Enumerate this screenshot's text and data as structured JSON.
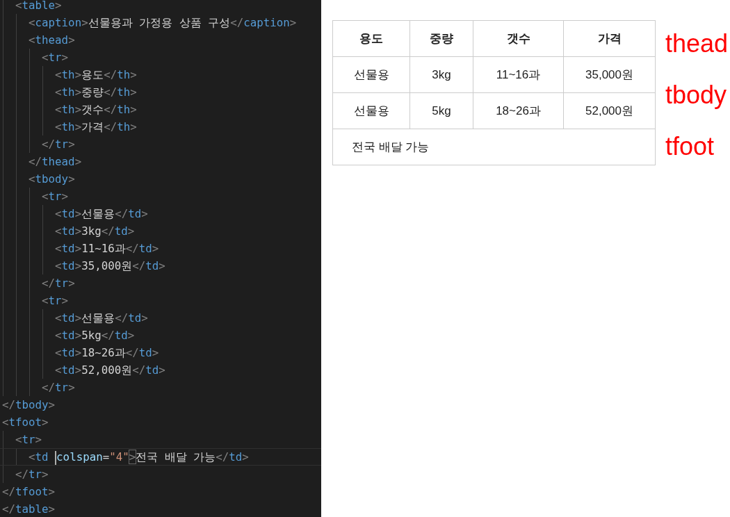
{
  "editor": {
    "lines": [
      {
        "current": false,
        "tokens": [
          {
            "kind": "punct",
            "text": "  <"
          },
          {
            "kind": "tag",
            "text": "table"
          },
          {
            "kind": "punct",
            "text": ">"
          }
        ]
      },
      {
        "current": false,
        "tokens": [
          {
            "kind": "punct",
            "text": "    <"
          },
          {
            "kind": "tag",
            "text": "caption"
          },
          {
            "kind": "punct",
            "text": ">"
          },
          {
            "kind": "text",
            "text": "선물용과 가정용 상품 구성"
          },
          {
            "kind": "punct",
            "text": "</"
          },
          {
            "kind": "tag",
            "text": "caption"
          },
          {
            "kind": "punct",
            "text": ">"
          }
        ]
      },
      {
        "current": false,
        "tokens": [
          {
            "kind": "punct",
            "text": "    <"
          },
          {
            "kind": "tag",
            "text": "thead"
          },
          {
            "kind": "punct",
            "text": ">"
          }
        ]
      },
      {
        "current": false,
        "tokens": [
          {
            "kind": "punct",
            "text": "      <"
          },
          {
            "kind": "tag",
            "text": "tr"
          },
          {
            "kind": "punct",
            "text": ">"
          }
        ]
      },
      {
        "current": false,
        "tokens": [
          {
            "kind": "punct",
            "text": "        <"
          },
          {
            "kind": "tag",
            "text": "th"
          },
          {
            "kind": "punct",
            "text": ">"
          },
          {
            "kind": "text",
            "text": "용도"
          },
          {
            "kind": "punct",
            "text": "</"
          },
          {
            "kind": "tag",
            "text": "th"
          },
          {
            "kind": "punct",
            "text": ">"
          }
        ]
      },
      {
        "current": false,
        "tokens": [
          {
            "kind": "punct",
            "text": "        <"
          },
          {
            "kind": "tag",
            "text": "th"
          },
          {
            "kind": "punct",
            "text": ">"
          },
          {
            "kind": "text",
            "text": "중량"
          },
          {
            "kind": "punct",
            "text": "</"
          },
          {
            "kind": "tag",
            "text": "th"
          },
          {
            "kind": "punct",
            "text": ">"
          }
        ]
      },
      {
        "current": false,
        "tokens": [
          {
            "kind": "punct",
            "text": "        <"
          },
          {
            "kind": "tag",
            "text": "th"
          },
          {
            "kind": "punct",
            "text": ">"
          },
          {
            "kind": "text",
            "text": "갯수"
          },
          {
            "kind": "punct",
            "text": "</"
          },
          {
            "kind": "tag",
            "text": "th"
          },
          {
            "kind": "punct",
            "text": ">"
          }
        ]
      },
      {
        "current": false,
        "tokens": [
          {
            "kind": "punct",
            "text": "        <"
          },
          {
            "kind": "tag",
            "text": "th"
          },
          {
            "kind": "punct",
            "text": ">"
          },
          {
            "kind": "text",
            "text": "가격"
          },
          {
            "kind": "punct",
            "text": "</"
          },
          {
            "kind": "tag",
            "text": "th"
          },
          {
            "kind": "punct",
            "text": ">"
          }
        ]
      },
      {
        "current": false,
        "tokens": [
          {
            "kind": "punct",
            "text": "      </"
          },
          {
            "kind": "tag",
            "text": "tr"
          },
          {
            "kind": "punct",
            "text": ">"
          }
        ]
      },
      {
        "current": false,
        "tokens": [
          {
            "kind": "punct",
            "text": "    </"
          },
          {
            "kind": "tag",
            "text": "thead"
          },
          {
            "kind": "punct",
            "text": ">"
          }
        ]
      },
      {
        "current": false,
        "tokens": [
          {
            "kind": "punct",
            "text": "    <"
          },
          {
            "kind": "tag",
            "text": "tbody"
          },
          {
            "kind": "punct",
            "text": ">"
          }
        ]
      },
      {
        "current": false,
        "tokens": [
          {
            "kind": "punct",
            "text": "      <"
          },
          {
            "kind": "tag",
            "text": "tr"
          },
          {
            "kind": "punct",
            "text": ">"
          }
        ]
      },
      {
        "current": false,
        "tokens": [
          {
            "kind": "punct",
            "text": "        <"
          },
          {
            "kind": "tag",
            "text": "td"
          },
          {
            "kind": "punct",
            "text": ">"
          },
          {
            "kind": "text",
            "text": "선물용"
          },
          {
            "kind": "punct",
            "text": "</"
          },
          {
            "kind": "tag",
            "text": "td"
          },
          {
            "kind": "punct",
            "text": ">"
          }
        ]
      },
      {
        "current": false,
        "tokens": [
          {
            "kind": "punct",
            "text": "        <"
          },
          {
            "kind": "tag",
            "text": "td"
          },
          {
            "kind": "punct",
            "text": ">"
          },
          {
            "kind": "text",
            "text": "3kg"
          },
          {
            "kind": "punct",
            "text": "</"
          },
          {
            "kind": "tag",
            "text": "td"
          },
          {
            "kind": "punct",
            "text": ">"
          }
        ]
      },
      {
        "current": false,
        "tokens": [
          {
            "kind": "punct",
            "text": "        <"
          },
          {
            "kind": "tag",
            "text": "td"
          },
          {
            "kind": "punct",
            "text": ">"
          },
          {
            "kind": "text",
            "text": "11~16과"
          },
          {
            "kind": "punct",
            "text": "</"
          },
          {
            "kind": "tag",
            "text": "td"
          },
          {
            "kind": "punct",
            "text": ">"
          }
        ]
      },
      {
        "current": false,
        "tokens": [
          {
            "kind": "punct",
            "text": "        <"
          },
          {
            "kind": "tag",
            "text": "td"
          },
          {
            "kind": "punct",
            "text": ">"
          },
          {
            "kind": "text",
            "text": "35,000원"
          },
          {
            "kind": "punct",
            "text": "</"
          },
          {
            "kind": "tag",
            "text": "td"
          },
          {
            "kind": "punct",
            "text": ">"
          }
        ]
      },
      {
        "current": false,
        "tokens": [
          {
            "kind": "punct",
            "text": "      </"
          },
          {
            "kind": "tag",
            "text": "tr"
          },
          {
            "kind": "punct",
            "text": ">"
          }
        ]
      },
      {
        "current": false,
        "tokens": [
          {
            "kind": "punct",
            "text": "      <"
          },
          {
            "kind": "tag",
            "text": "tr"
          },
          {
            "kind": "punct",
            "text": ">"
          }
        ]
      },
      {
        "current": false,
        "tokens": [
          {
            "kind": "punct",
            "text": "        <"
          },
          {
            "kind": "tag",
            "text": "td"
          },
          {
            "kind": "punct",
            "text": ">"
          },
          {
            "kind": "text",
            "text": "선물용"
          },
          {
            "kind": "punct",
            "text": "</"
          },
          {
            "kind": "tag",
            "text": "td"
          },
          {
            "kind": "punct",
            "text": ">"
          }
        ]
      },
      {
        "current": false,
        "tokens": [
          {
            "kind": "punct",
            "text": "        <"
          },
          {
            "kind": "tag",
            "text": "td"
          },
          {
            "kind": "punct",
            "text": ">"
          },
          {
            "kind": "text",
            "text": "5kg"
          },
          {
            "kind": "punct",
            "text": "</"
          },
          {
            "kind": "tag",
            "text": "td"
          },
          {
            "kind": "punct",
            "text": ">"
          }
        ]
      },
      {
        "current": false,
        "tokens": [
          {
            "kind": "punct",
            "text": "        <"
          },
          {
            "kind": "tag",
            "text": "td"
          },
          {
            "kind": "punct",
            "text": ">"
          },
          {
            "kind": "text",
            "text": "18~26과"
          },
          {
            "kind": "punct",
            "text": "</"
          },
          {
            "kind": "tag",
            "text": "td"
          },
          {
            "kind": "punct",
            "text": ">"
          }
        ]
      },
      {
        "current": false,
        "tokens": [
          {
            "kind": "punct",
            "text": "        <"
          },
          {
            "kind": "tag",
            "text": "td"
          },
          {
            "kind": "punct",
            "text": ">"
          },
          {
            "kind": "text",
            "text": "52,000원"
          },
          {
            "kind": "punct",
            "text": "</"
          },
          {
            "kind": "tag",
            "text": "td"
          },
          {
            "kind": "punct",
            "text": ">"
          }
        ]
      },
      {
        "current": false,
        "tokens": [
          {
            "kind": "punct",
            "text": "      </"
          },
          {
            "kind": "tag",
            "text": "tr"
          },
          {
            "kind": "punct",
            "text": ">"
          }
        ]
      },
      {
        "current": false,
        "tokens": [
          {
            "kind": "punct",
            "text": "</"
          },
          {
            "kind": "tag",
            "text": "tbody"
          },
          {
            "kind": "punct",
            "text": ">"
          }
        ]
      },
      {
        "current": false,
        "tokens": [
          {
            "kind": "punct",
            "text": "<"
          },
          {
            "kind": "tag",
            "text": "tfoot"
          },
          {
            "kind": "punct",
            "text": ">"
          }
        ]
      },
      {
        "current": false,
        "tokens": [
          {
            "kind": "punct",
            "text": "  <"
          },
          {
            "kind": "tag",
            "text": "tr"
          },
          {
            "kind": "punct",
            "text": ">"
          }
        ]
      },
      {
        "current": true,
        "tokens": [
          {
            "kind": "punct",
            "text": "    <"
          },
          {
            "kind": "tag",
            "text": "td"
          },
          {
            "kind": "attr",
            "text": " colspan"
          },
          {
            "kind": "text",
            "text": "="
          },
          {
            "kind": "string",
            "text": "\"4\""
          },
          {
            "kind": "punct",
            "text": ">"
          },
          {
            "kind": "text",
            "text": "전국 배달 가능"
          },
          {
            "kind": "punct",
            "text": "</"
          },
          {
            "kind": "tag",
            "text": "td"
          },
          {
            "kind": "punct",
            "text": ">"
          }
        ]
      },
      {
        "current": false,
        "tokens": [
          {
            "kind": "punct",
            "text": "  </"
          },
          {
            "kind": "tag",
            "text": "tr"
          },
          {
            "kind": "punct",
            "text": ">"
          }
        ]
      },
      {
        "current": false,
        "tokens": [
          {
            "kind": "punct",
            "text": "</"
          },
          {
            "kind": "tag",
            "text": "tfoot"
          },
          {
            "kind": "punct",
            "text": ">"
          }
        ]
      },
      {
        "current": false,
        "tokens": [
          {
            "kind": "punct",
            "text": "</"
          },
          {
            "kind": "tag",
            "text": "table"
          },
          {
            "kind": "punct",
            "text": ">"
          }
        ]
      }
    ]
  },
  "preview": {
    "header": [
      "용도",
      "중량",
      "갯수",
      "가격"
    ],
    "rows": [
      [
        "선물용",
        "3kg",
        "11~16과",
        "35,000원"
      ],
      [
        "선물용",
        "5kg",
        "18~26과",
        "52,000원"
      ]
    ],
    "footer": "전국 배달 가능",
    "section_labels": [
      "thead",
      "tbody",
      "tfoot"
    ]
  }
}
